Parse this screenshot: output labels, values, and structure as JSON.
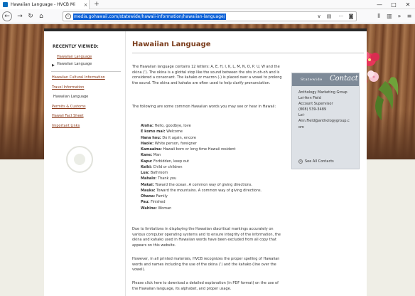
{
  "browser": {
    "tab_title": "Hawaiian Language - HVCB Mi",
    "tab_close": "×",
    "new_tab": "+",
    "url": "media.gohawaii.com/statewide/hawaii-information/hawaiian-language/",
    "window_controls": [
      "—",
      "□",
      "✕"
    ],
    "icons": [
      "back-icon",
      "forward-icon",
      "reload-icon",
      "home-icon",
      "info-icon",
      "dropdown-icon",
      "reader-icon",
      "more-icon",
      "pocket-icon",
      "library-icon",
      "sidebar-icon",
      "overflow-icon",
      "menu-icon"
    ]
  },
  "sidebar": {
    "heading": "RECENTLY VIEWED:",
    "recent": [
      "Hawaiian Language",
      "Hawaiian Language"
    ],
    "links": [
      {
        "label": "Hawaiian Cultural Information",
        "current": false
      },
      {
        "label": "Travel Information",
        "current": false
      },
      {
        "label": "Hawaiian Language",
        "current": true
      },
      {
        "label": "Permits & Customs",
        "current": false
      },
      {
        "label": "Hawaii Fact Sheet",
        "current": false
      },
      {
        "label": "Important Links",
        "current": false
      }
    ]
  },
  "main": {
    "title": "Hawaiian Language",
    "intro": "The Hawaiian language contains 12 letters: A, E, H, I, K, L, M, N, O, P, U, W and the okina (‘). The okina is a glottal stop like the sound between the ohs in oh-oh and is considered a consonant. The kahako or macron (-) is placed over a vowel to prolong the sound. The okina and kahako are often used to help clarify pronunciation.",
    "lead": "The following are some common Hawaiian words you may see or hear in Hawaii:",
    "words": [
      {
        "term": "Aloha:",
        "meaning": "Hello, goodbye, love"
      },
      {
        "term": "E komo mai:",
        "meaning": "Welcome"
      },
      {
        "term": "Hana hou:",
        "meaning": "Do it again, encore"
      },
      {
        "term": "Haole:",
        "meaning": "White person, foreigner"
      },
      {
        "term": "Kamaaina:",
        "meaning": "Hawaii born or long time Hawaii resident"
      },
      {
        "term": "Kane:",
        "meaning": "Man"
      },
      {
        "term": "Kapu:",
        "meaning": "Forbidden, keep out"
      },
      {
        "term": "Keiki:",
        "meaning": "Child or children"
      },
      {
        "term": "Lua:",
        "meaning": "Bathroom"
      },
      {
        "term": "Mahalo:",
        "meaning": "Thank you"
      },
      {
        "term": "Makai:",
        "meaning": "Toward the ocean. A common way of giving directions."
      },
      {
        "term": "Mauka:",
        "meaning": "Toward the mountains. A common way of giving directions."
      },
      {
        "term": "Ohana:",
        "meaning": "Family"
      },
      {
        "term": "Pau:",
        "meaning": "Finished"
      },
      {
        "term": "Wahine:",
        "meaning": "Woman"
      }
    ],
    "limitations": "Due to limitations in displaying the Hawaiian diacritical markings accurately on various computer operating systems and to ensure integrity of the information, the okina and kahako used in Hawaiian words have been excluded from all copy that appears on this website.",
    "printed": "However, in all printed materials, HVCB recognizes the proper spelling of Hawaiian words and names including the use of the okina (‘) and the kahako (line over the vowel).",
    "download": "Please click here to download a detailed explanation (in PDF format) on the use of the Hawaiian language, its alphabet, and proper usage."
  },
  "contact": {
    "statewide": "Statewide",
    "contact_word": "Contact",
    "lines": [
      "Anthology Marketing Group",
      "Lei-Ann Field",
      "Account Supervisor",
      "(808) 539-3489",
      "Lei-",
      "Ann.Field@anthologygroup.c",
      "om"
    ],
    "all_contacts": "See All Contacts"
  },
  "colors": {
    "link": "#8b3a1a",
    "title": "#7a3b1a",
    "contact_head": "#7e8a98",
    "url_highlight": "#0a5fd6"
  }
}
